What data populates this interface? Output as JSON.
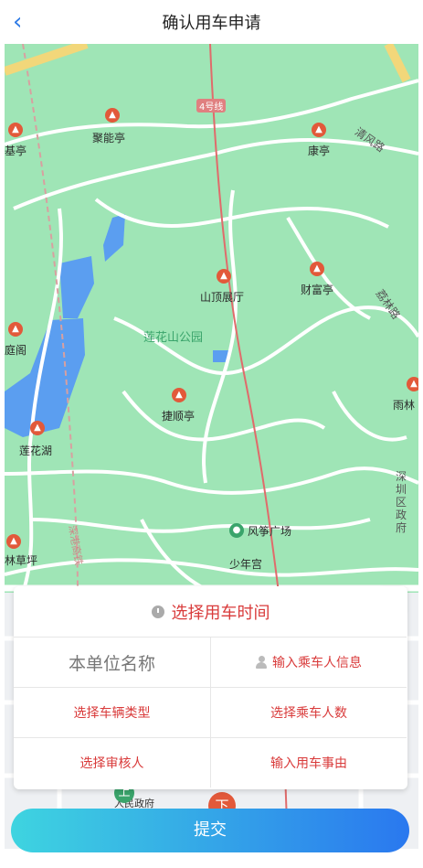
{
  "header": {
    "title": "确认用车申请",
    "back_icon": "chevron-left-icon"
  },
  "map": {
    "park_label": "莲花山公园",
    "pois": [
      {
        "label": "聚能亭"
      },
      {
        "label": "康亭"
      },
      {
        "label": "山顶展厅"
      },
      {
        "label": "财富亭"
      },
      {
        "label": "捷顺亭"
      },
      {
        "label": "莲花湖"
      },
      {
        "label": "风筝广场"
      },
      {
        "label": "少年宫"
      },
      {
        "label": "雨林"
      },
      {
        "label": "林草坪"
      },
      {
        "label": "基亭"
      },
      {
        "label": "庭阁"
      }
    ],
    "roads": [
      "清风路",
      "荔林路",
      "4号线",
      "深港高铁",
      "深圳区政府",
      "人民政府"
    ],
    "stations": {
      "on": "上",
      "off": "下"
    }
  },
  "card": {
    "time_label": "选择用车时间",
    "unit_placeholder": "本单位名称",
    "passenger_info": "输入乘车人信息",
    "vehicle_type": "选择车辆类型",
    "passenger_count": "选择乘车人数",
    "reviewer": "选择审核人",
    "reason": "输入用车事由"
  },
  "submit_label": "提交",
  "colors": {
    "accent": "#2f7be6",
    "red": "#d93b3b",
    "map_green": "#9fe5b6",
    "water": "#5b9ef0"
  }
}
